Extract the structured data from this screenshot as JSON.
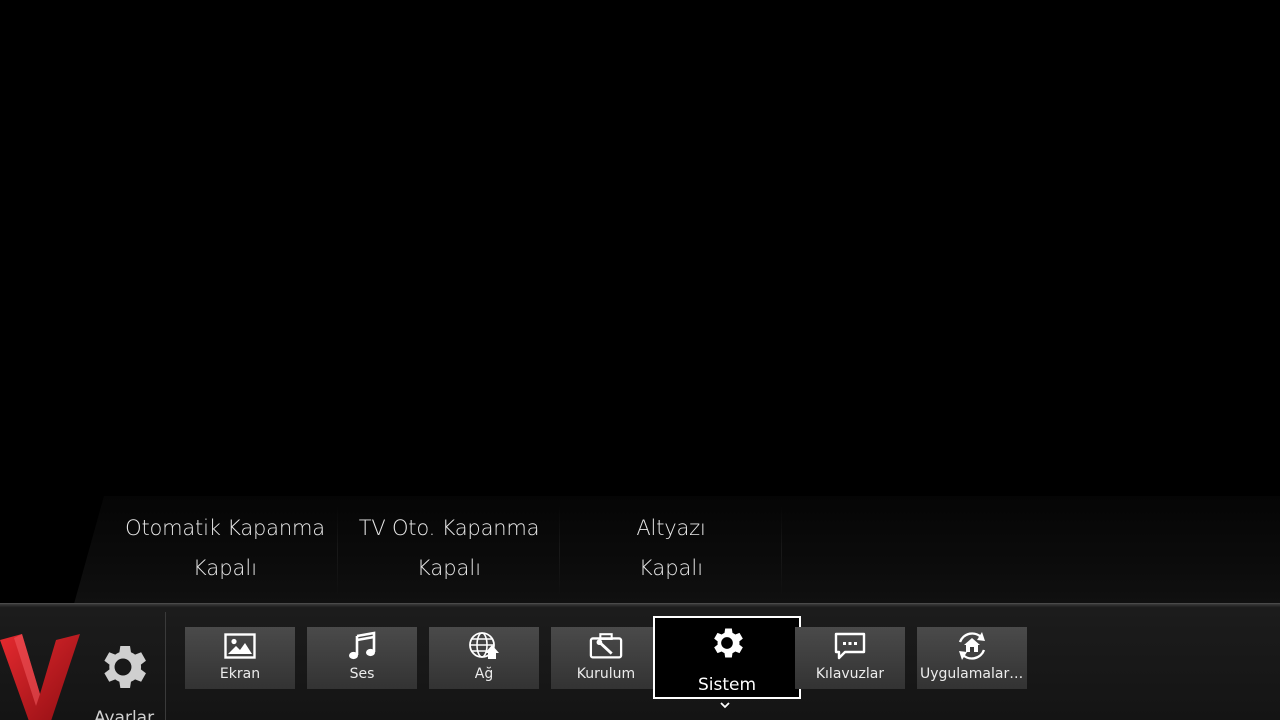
{
  "submenu": {
    "items": [
      {
        "title": "Otomatik Kapanma",
        "value": "Kapalı"
      },
      {
        "title": "TV Oto. Kapanma",
        "value": "Kapalı"
      },
      {
        "title": "Altyazı",
        "value": "Kapalı"
      }
    ]
  },
  "menu": {
    "settings_label": "Ayarlar",
    "tabs": [
      {
        "label": "Ekran",
        "icon": "picture-icon"
      },
      {
        "label": "Ses",
        "icon": "music-note-icon"
      },
      {
        "label": "Ağ",
        "icon": "globe-network-icon"
      },
      {
        "label": "Kurulum",
        "icon": "toolbox-icon"
      },
      {
        "label": "Sistem",
        "icon": "gear-icon",
        "selected": true
      },
      {
        "label": "Kılavuzlar",
        "icon": "chat-bubble-icon"
      },
      {
        "label": "Uygulamaları S..",
        "icon": "home-refresh-icon"
      }
    ]
  },
  "colors": {
    "background": "#000000",
    "logo_red": "#c4161c",
    "tab_bg": "#404040",
    "selected_border": "#ffffff"
  }
}
